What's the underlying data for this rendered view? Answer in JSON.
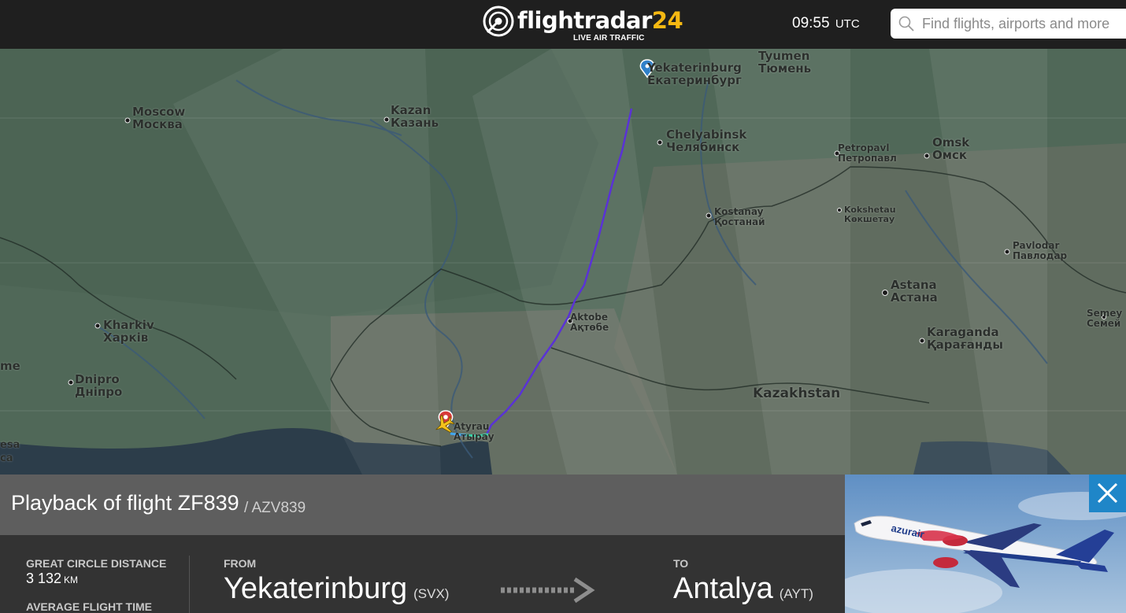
{
  "header": {
    "logo_word": "flightradar",
    "logo_num": "24",
    "logo_sub": "LIVE AIR TRAFFIC",
    "time": "09:55",
    "time_zone": "UTC",
    "search_placeholder": "Find flights, airports and more"
  },
  "map": {
    "cities": {
      "moscow": [
        "Moscow",
        "Москва"
      ],
      "kazan": [
        "Kazan",
        "Казань"
      ],
      "yekaterinburg": [
        "Yekaterinburg",
        "Екатеринбург"
      ],
      "tyumen": [
        "Tyumen",
        "Тюмень"
      ],
      "chelyabinsk": [
        "Chelyabinsk",
        "Челябинск"
      ],
      "petropavl": [
        "Petropavl",
        "Петропавл"
      ],
      "omsk": [
        "Omsk",
        "Омск"
      ],
      "kostanay": [
        "Kostanay",
        "Қостанай"
      ],
      "kokshetau": [
        "Kokshetau",
        "Көкшетау"
      ],
      "pavlodar": [
        "Pavlodar",
        "Павлодар"
      ],
      "astana": [
        "Astana",
        "Астана"
      ],
      "aktobe": [
        "Aktobe",
        "Ақтөбе"
      ],
      "kharkiv": [
        "Kharkiv",
        "Харків"
      ],
      "dnipro": [
        "Dnipro",
        "Дніпро"
      ],
      "karaganda": [
        "Karaganda",
        "Қарағанды"
      ],
      "semey": [
        "Semey",
        "Семей"
      ],
      "atyrau": [
        "Atyrau",
        "Атырау"
      ]
    },
    "country": "Kazakhstan",
    "edge_labels": {
      "left_me": "me",
      "left_esa_1": "esa",
      "left_esa_2": "са"
    }
  },
  "flight": {
    "title": "Playback of flight ZF839",
    "callsign": "/ AZV839",
    "distance_label": "GREAT CIRCLE DISTANCE",
    "distance_value": "3 132",
    "distance_unit": "KM",
    "avg_time_label": "AVERAGE FLIGHT TIME",
    "from_label": "FROM",
    "from_city": "Yekaterinburg",
    "from_code": "(SVX)",
    "to_label": "TO",
    "to_city": "Antalya",
    "to_code": "(AYT)"
  },
  "aircraft_photo": {
    "airline_text": "azurair"
  },
  "colors": {
    "accent": "#1f86c8",
    "track": "#5a32d6",
    "brand_yellow": "#f5b812"
  }
}
